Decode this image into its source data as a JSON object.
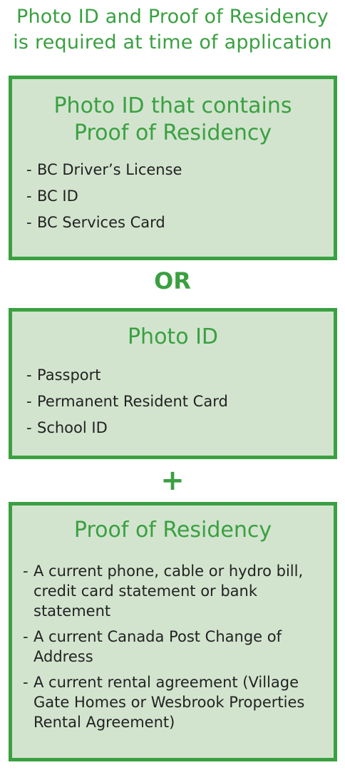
{
  "header": {
    "line1": "Photo ID and Proof of Residency",
    "line2": "is required at time of application"
  },
  "option_photo_id_with_residency": {
    "title_line1": "Photo ID that contains",
    "title_line2": "Proof of Residency",
    "items": [
      "BC Driver’s License",
      "BC ID",
      "BC Services Card"
    ]
  },
  "or_label": "OR",
  "option_photo_id": {
    "title": "Photo ID",
    "items": [
      "Passport",
      "Permanent Resident Card",
      "School ID"
    ]
  },
  "plus_label": "+",
  "proof_of_residency": {
    "title": "Proof of Residency",
    "items": [
      "A current phone, cable or hydro bill, credit card statement or bank statement",
      "A current Canada Post Change of Address",
      "A current rental agreement (Village Gate Homes or Wesbrook Properties Rental Agreement)"
    ]
  },
  "colors": {
    "accent_green": "#3aa041",
    "box_fill": "#d2e4ce",
    "text_dark": "#222222"
  }
}
